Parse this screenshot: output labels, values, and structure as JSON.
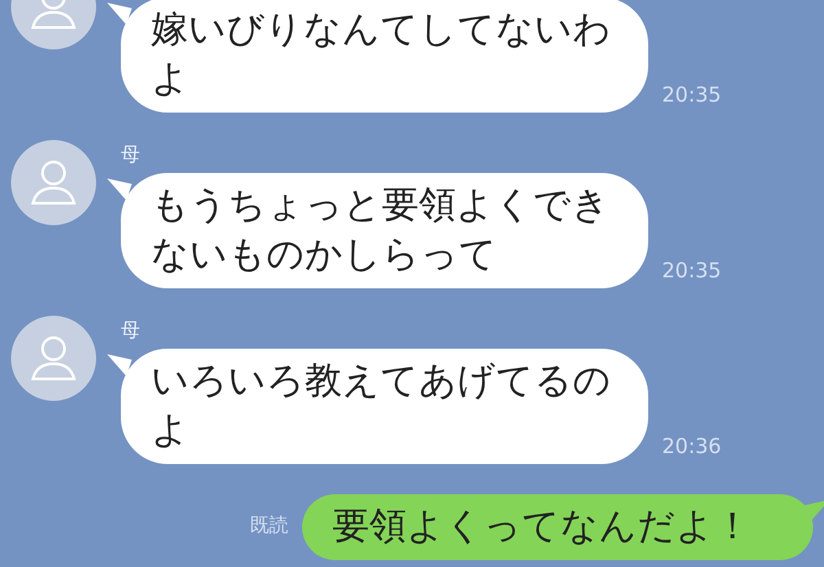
{
  "messages": [
    {
      "kind": "received",
      "text": "嫁いびりなんてしてないわよ",
      "time": "20:35"
    },
    {
      "kind": "received",
      "sender": "母",
      "text": "もうちょっと要領よくできないものかしらって",
      "time": "20:35"
    },
    {
      "kind": "received",
      "sender": "母",
      "text": "いろいろ教えてあげてるのよ",
      "time": "20:36"
    },
    {
      "kind": "sent",
      "text": "要領よくってなんだよ！",
      "read": "既読"
    }
  ]
}
